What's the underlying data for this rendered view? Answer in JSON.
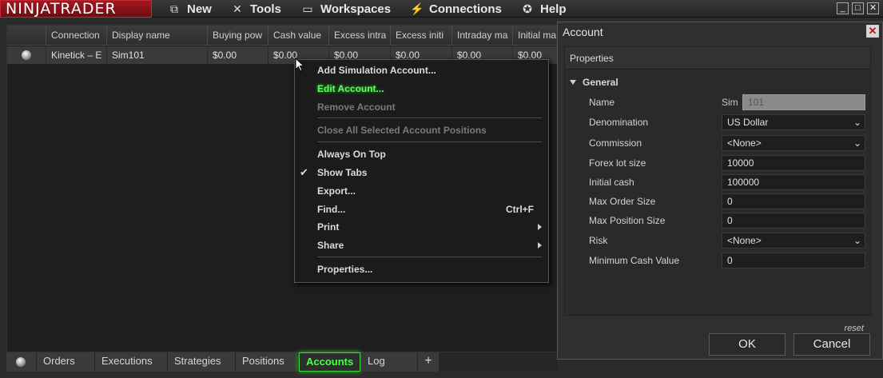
{
  "topbar": {
    "logo": "NINJATRADER",
    "menu": [
      {
        "label": "New",
        "icon": "new-window-icon"
      },
      {
        "label": "Tools",
        "icon": "tools-icon"
      },
      {
        "label": "Workspaces",
        "icon": "workspaces-icon"
      },
      {
        "label": "Connections",
        "icon": "plug-icon"
      },
      {
        "label": "Help",
        "icon": "lifebuoy-icon"
      }
    ]
  },
  "grid": {
    "headers": [
      "Connection",
      "Display name",
      "Buying pow",
      "Cash value",
      "Excess intra",
      "Excess initi",
      "Intraday ma",
      "Initial ma"
    ],
    "row": [
      "Kinetick – E",
      "Sim101",
      "$0.00",
      "$0.00",
      "$0.00",
      "$0.00",
      "$0.00",
      "$0.00"
    ]
  },
  "context_menu": {
    "add_sim": "Add Simulation Account...",
    "edit": "Edit Account...",
    "remove": "Remove Account",
    "close_all": "Close All Selected Account Positions",
    "always_on_top": "Always On Top",
    "show_tabs": "Show Tabs",
    "export": "Export...",
    "find": "Find...",
    "find_shortcut": "Ctrl+F",
    "print": "Print",
    "share": "Share",
    "properties": "Properties..."
  },
  "tabs": [
    "Orders",
    "Executions",
    "Strategies",
    "Positions",
    "Accounts",
    "Log"
  ],
  "tabs_add": "+",
  "dialog": {
    "title": "Account",
    "section": "Properties",
    "group": "General",
    "name_label": "Name",
    "name_prefix": "Sim",
    "name_value": "101",
    "fields": [
      {
        "label": "Denomination",
        "value": "US Dollar",
        "dropdown": true
      },
      {
        "label": "Commission",
        "value": "<None>",
        "dropdown": true
      },
      {
        "label": "Forex lot size",
        "value": "10000",
        "dropdown": false
      },
      {
        "label": "Initial cash",
        "value": "100000",
        "dropdown": false
      },
      {
        "label": "Max Order Size",
        "value": "0",
        "dropdown": false
      },
      {
        "label": "Max Position Size",
        "value": "0",
        "dropdown": false
      },
      {
        "label": "Risk",
        "value": "<None>",
        "dropdown": true
      },
      {
        "label": "Minimum Cash Value",
        "value": "0",
        "dropdown": false
      }
    ],
    "reset": "reset",
    "ok": "OK",
    "cancel": "Cancel"
  },
  "colors": {
    "accent_green": "#4cff4c",
    "brand_red": "#a01820"
  }
}
